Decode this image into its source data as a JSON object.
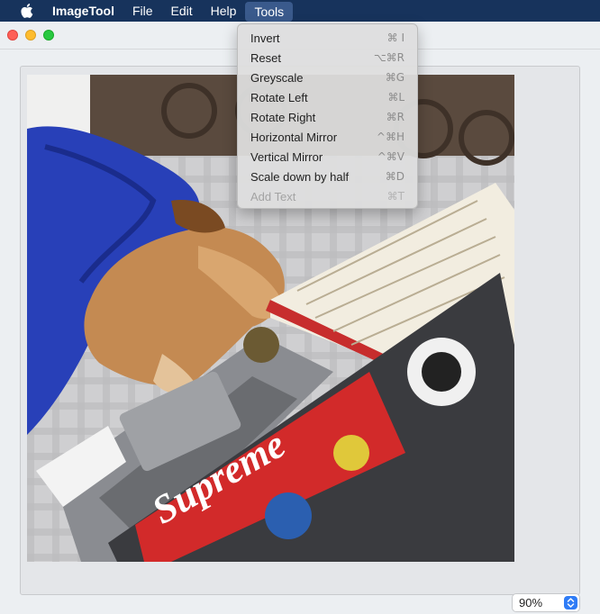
{
  "menubar": {
    "apple": "apple-icon",
    "app_name": "ImageTool",
    "items": [
      "File",
      "Edit",
      "Help",
      "Tools"
    ]
  },
  "window": {
    "zoom": "90%"
  },
  "tools_menu": {
    "items": [
      {
        "label": "Invert",
        "shortcut": "⌘ I",
        "enabled": true
      },
      {
        "label": "Reset",
        "shortcut": "⌥⌘R",
        "enabled": true
      },
      {
        "label": "Greyscale",
        "shortcut": "⌘G",
        "enabled": true
      },
      {
        "label": "Rotate Left",
        "shortcut": "⌘L",
        "enabled": true
      },
      {
        "label": "Rotate Right",
        "shortcut": "⌘R",
        "enabled": true
      },
      {
        "label": "Horizontal Mirror",
        "shortcut": "^⌘H",
        "enabled": true
      },
      {
        "label": "Vertical Mirror",
        "shortcut": "^⌘V",
        "enabled": true
      },
      {
        "label": "Scale down by half",
        "shortcut": "⌘D",
        "enabled": true
      },
      {
        "label": "Add Text",
        "shortcut": "⌘T",
        "enabled": false
      }
    ]
  },
  "photo": {
    "sticker_text": "Supreme"
  },
  "colors": {
    "menubar": "#17335c",
    "accent": "#2f7cf6"
  }
}
